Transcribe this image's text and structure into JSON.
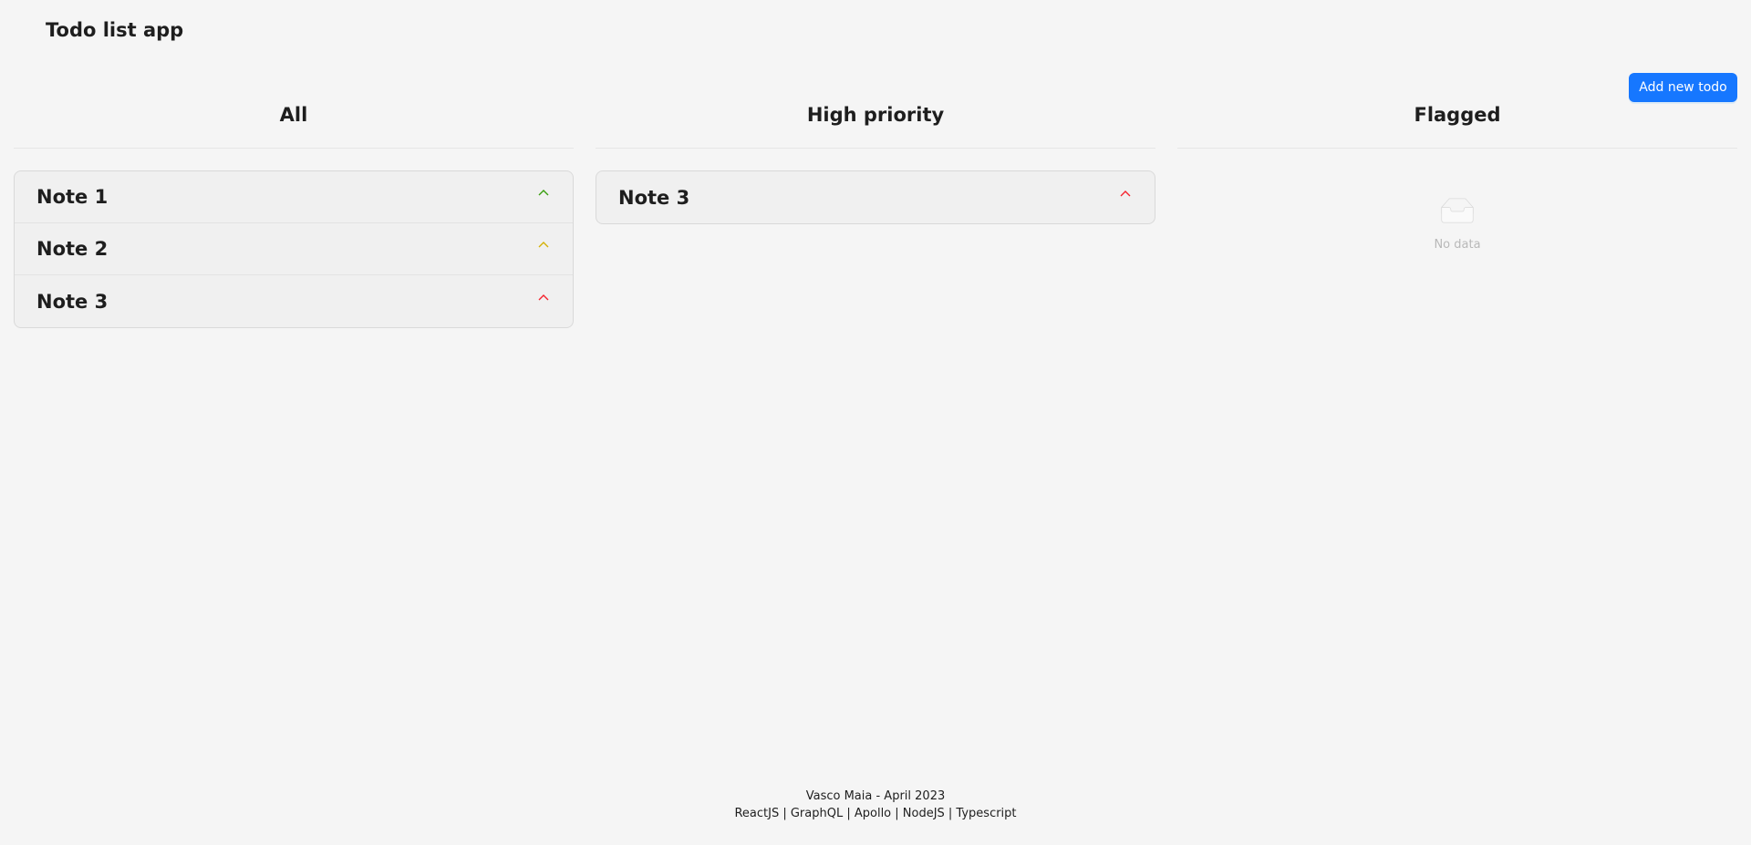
{
  "app": {
    "title": "Todo list app",
    "add_button_label": "Add new todo"
  },
  "columns": {
    "all": {
      "title": "All",
      "items": [
        {
          "label": "Note 1",
          "priority": "low",
          "chevron_color": "#389e0d"
        },
        {
          "label": "Note 2",
          "priority": "medium",
          "chevron_color": "#d4b106"
        },
        {
          "label": "Note 3",
          "priority": "high",
          "chevron_color": "#f5222d"
        }
      ]
    },
    "high_priority": {
      "title": "High priority",
      "items": [
        {
          "label": "Note 3",
          "priority": "high",
          "chevron_color": "#f5222d"
        }
      ]
    },
    "flagged": {
      "title": "Flagged",
      "empty_text": "No data"
    }
  },
  "footer": {
    "line1": "Vasco Maia - April 2023",
    "line2": "ReactJS | GraphQL | Apollo | NodeJS | Typescript"
  },
  "colors": {
    "primary": "#1677ff",
    "background": "#f5f5f5"
  },
  "icons": {
    "chevron": "chevron-up-icon",
    "empty": "empty-inbox-icon"
  }
}
